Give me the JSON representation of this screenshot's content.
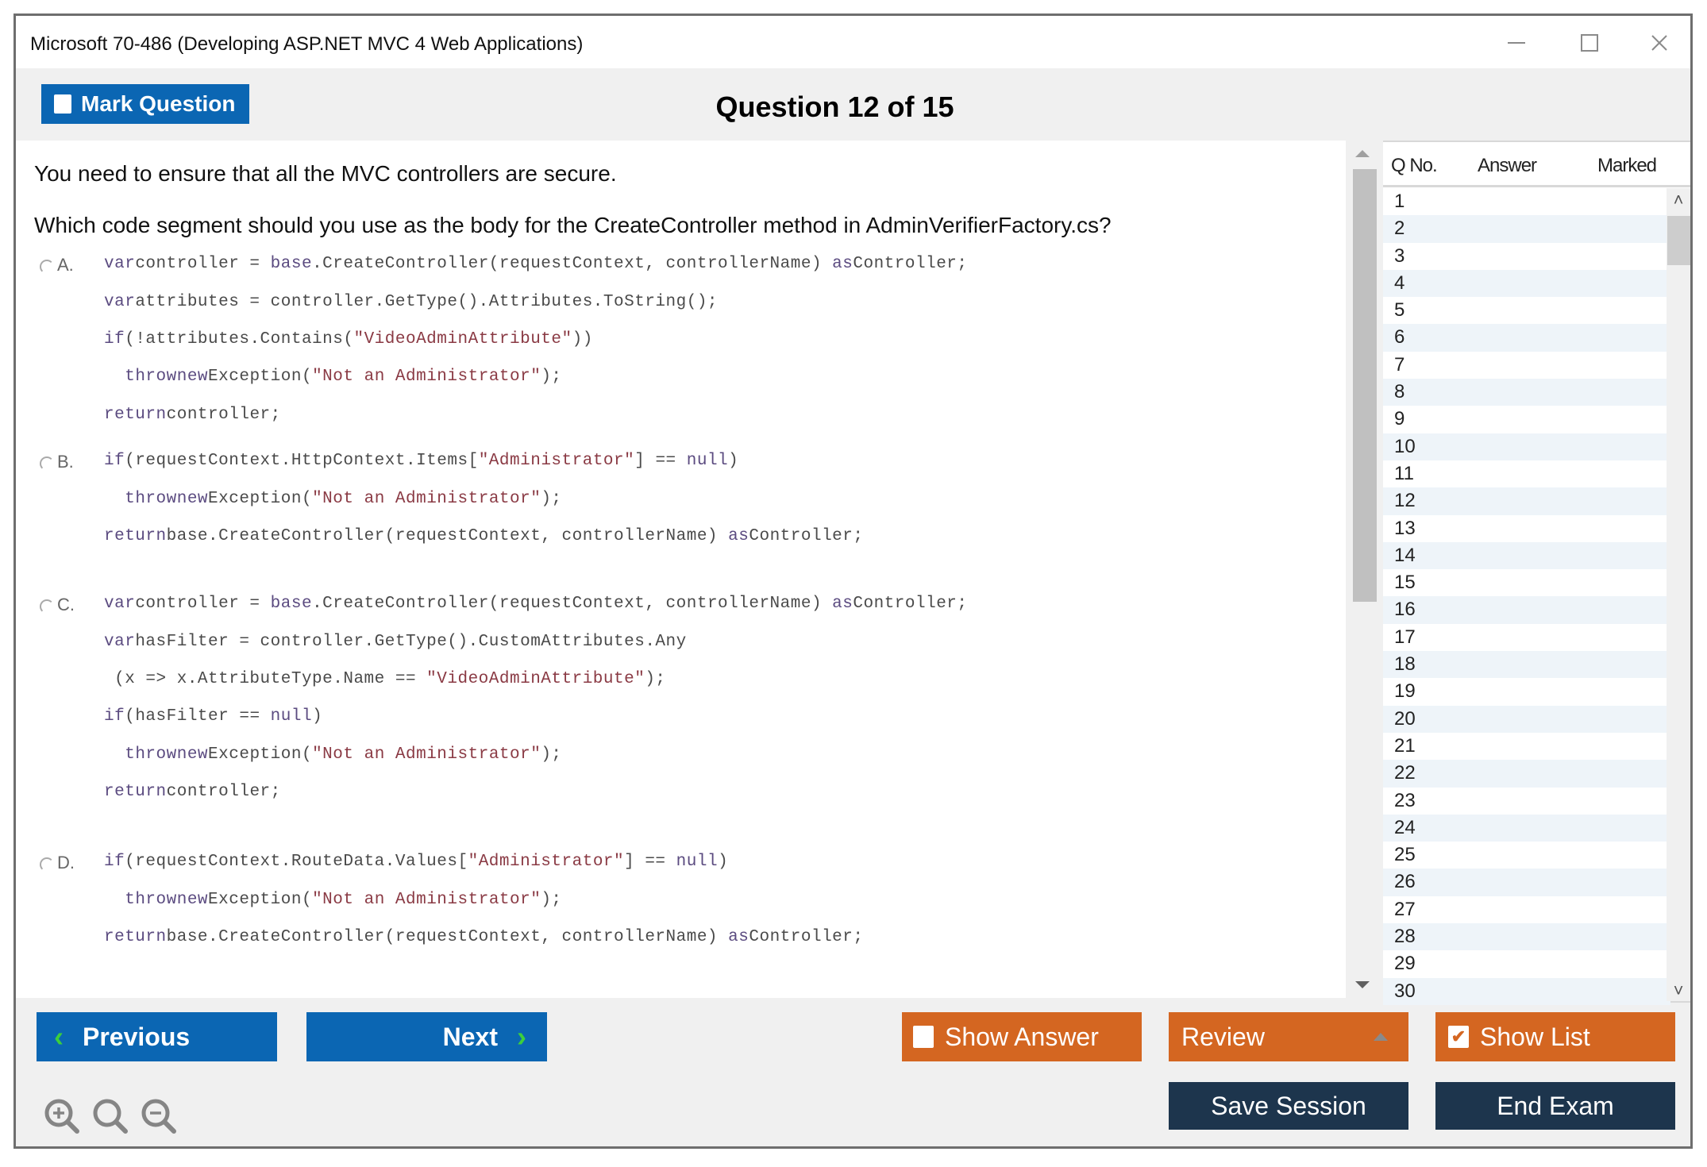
{
  "window": {
    "title": "Microsoft 70-486 (Developing ASP.NET MVC 4 Web Applications)",
    "controls": [
      "minimize-icon",
      "maximize-icon",
      "close-icon"
    ]
  },
  "header": {
    "mark_question_label": "Mark Question",
    "question_counter": "Question 12 of 15"
  },
  "question": {
    "line1": "You need to ensure that all the MVC controllers are secure.",
    "line2": "Which code segment should you use as the body for the CreateController method in AdminVerifierFactory.cs?"
  },
  "options": [
    {
      "letter": "A.",
      "lines": [
        "varcontroller = base.CreateController(requestContext, controllerName) asController;",
        "varattributes = controller.GetType().Attributes.ToString();",
        "if(!attributes.Contains(\"VideoAdminAttribute\"))",
        "  thrownewException(\"Not an Administrator\");",
        "returncontroller;"
      ]
    },
    {
      "letter": "B.",
      "lines": [
        "if(requestContext.HttpContext.Items[\"Administrator\"] == null)",
        "  thrownewException(\"Not an Administrator\");",
        "returnbase.CreateController(requestContext, controllerName) asController;"
      ]
    },
    {
      "letter": "C.",
      "lines": [
        "varcontroller = base.CreateController(requestContext, controllerName) asController;",
        "varhasFilter = controller.GetType().CustomAttributes.Any",
        " (x => x.AttributeType.Name == \"VideoAdminAttribute\");",
        "if(hasFilter == null)",
        "  thrownewException(\"Not an Administrator\");",
        "returncontroller;"
      ]
    },
    {
      "letter": "D.",
      "lines": [
        "if(requestContext.RouteData.Values[\"Administrator\"] == null)",
        "  thrownewException(\"Not an Administrator\");",
        "returnbase.CreateController(requestContext, controllerName) asController;"
      ]
    }
  ],
  "question_list": {
    "columns": [
      "Q No.",
      "Answer",
      "Marked"
    ],
    "rows": [
      {
        "no": "1",
        "answer": "",
        "marked": ""
      },
      {
        "no": "2",
        "answer": "",
        "marked": ""
      },
      {
        "no": "3",
        "answer": "",
        "marked": ""
      },
      {
        "no": "4",
        "answer": "",
        "marked": ""
      },
      {
        "no": "5",
        "answer": "",
        "marked": ""
      },
      {
        "no": "6",
        "answer": "",
        "marked": ""
      },
      {
        "no": "7",
        "answer": "",
        "marked": ""
      },
      {
        "no": "8",
        "answer": "",
        "marked": ""
      },
      {
        "no": "9",
        "answer": "",
        "marked": ""
      },
      {
        "no": "10",
        "answer": "",
        "marked": ""
      },
      {
        "no": "11",
        "answer": "",
        "marked": ""
      },
      {
        "no": "12",
        "answer": "",
        "marked": ""
      },
      {
        "no": "13",
        "answer": "",
        "marked": ""
      },
      {
        "no": "14",
        "answer": "",
        "marked": ""
      },
      {
        "no": "15",
        "answer": "",
        "marked": ""
      },
      {
        "no": "16",
        "answer": "",
        "marked": ""
      },
      {
        "no": "17",
        "answer": "",
        "marked": ""
      },
      {
        "no": "18",
        "answer": "",
        "marked": ""
      },
      {
        "no": "19",
        "answer": "",
        "marked": ""
      },
      {
        "no": "20",
        "answer": "",
        "marked": ""
      },
      {
        "no": "21",
        "answer": "",
        "marked": ""
      },
      {
        "no": "22",
        "answer": "",
        "marked": ""
      },
      {
        "no": "23",
        "answer": "",
        "marked": ""
      },
      {
        "no": "24",
        "answer": "",
        "marked": ""
      },
      {
        "no": "25",
        "answer": "",
        "marked": ""
      },
      {
        "no": "26",
        "answer": "",
        "marked": ""
      },
      {
        "no": "27",
        "answer": "",
        "marked": ""
      },
      {
        "no": "28",
        "answer": "",
        "marked": ""
      },
      {
        "no": "29",
        "answer": "",
        "marked": ""
      },
      {
        "no": "30",
        "answer": "",
        "marked": ""
      }
    ]
  },
  "footer": {
    "previous_label": "Previous",
    "next_label": "Next",
    "show_answer_label": "Show Answer",
    "show_answer_checked": false,
    "review_label": "Review",
    "show_list_label": "Show List",
    "show_list_checked": true,
    "save_session_label": "Save Session",
    "end_exam_label": "End Exam",
    "zoom_icons": [
      "zoom-in-icon",
      "zoom-reset-icon",
      "zoom-out-icon"
    ]
  },
  "colors": {
    "primary_blue": "#0b66b3",
    "accent_orange": "#d46621",
    "navy": "#1d354d",
    "arrow_green": "#3ccf3c",
    "row_alt": "#eef4f9"
  }
}
